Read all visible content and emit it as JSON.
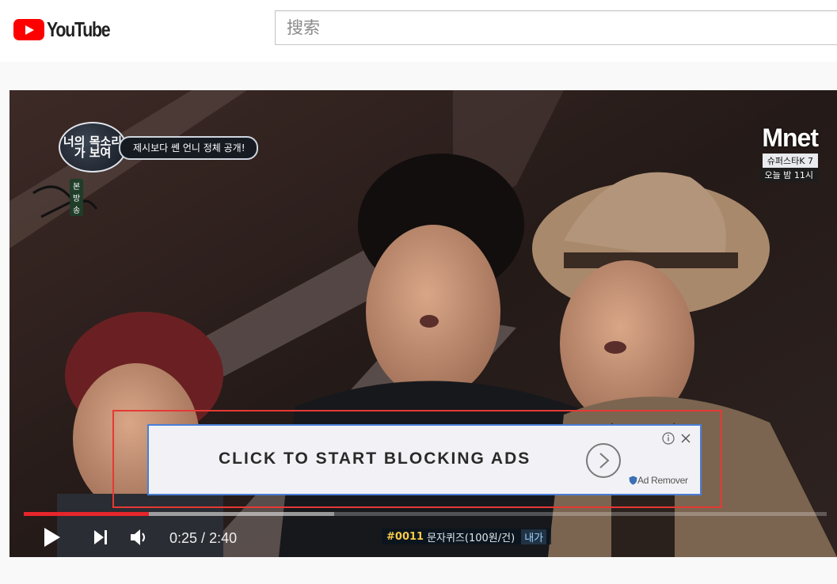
{
  "header": {
    "logo_text": "YouTube",
    "search_placeholder": "搜索"
  },
  "video": {
    "overlay_title": "제시보다 쎈 언니 정체 공개!",
    "show_logo_text": "너의 목소리가 보여",
    "show_badge": "본방송",
    "channel_logo": "Mnet",
    "promo_line_1": "슈퍼스타K 7",
    "promo_line_2": "오늘 밤 11시",
    "ticker_code": "#0011",
    "ticker_label": "문자퀴즈(100원/건)",
    "ticker_tag": "내가"
  },
  "ad": {
    "text": "CLICK TO START BLOCKING ADS",
    "brand": "Ad Remover"
  },
  "player": {
    "current_time": "0:25",
    "separator": " / ",
    "duration": "2:40",
    "progress_fraction": 0.156,
    "buffered_fraction": 0.387
  },
  "colors": {
    "brand_red": "#ff0000",
    "progress_red": "#e6262b",
    "ad_border_blue": "#4a7fd6",
    "highlight_red": "#e53935"
  },
  "icons": {
    "logo": "youtube-play-icon",
    "play": "play-icon",
    "next": "next-icon",
    "volume": "volume-icon",
    "ad_arrow": "chevron-right-circle-icon",
    "ad_info": "info-icon",
    "ad_close": "close-icon",
    "ad_brand": "shield-icon"
  }
}
